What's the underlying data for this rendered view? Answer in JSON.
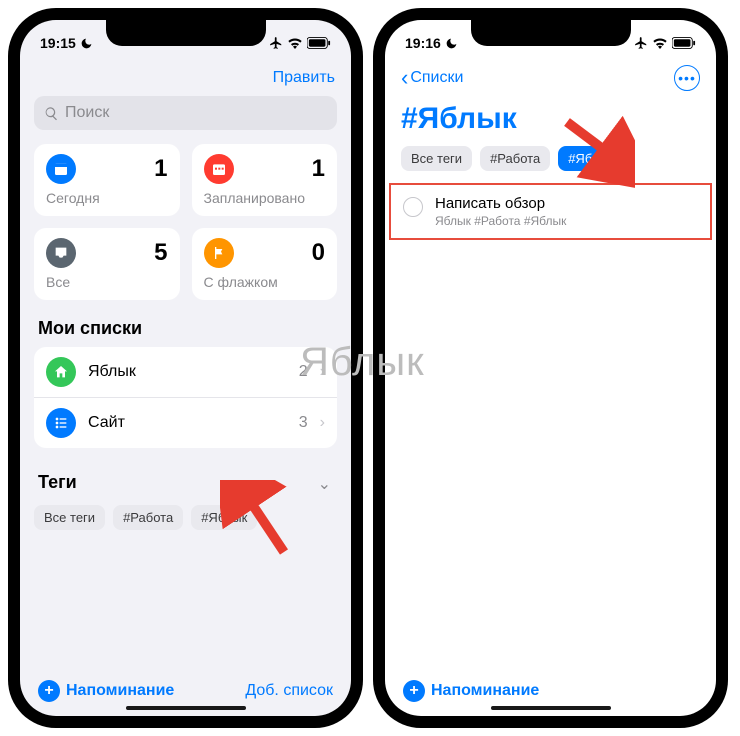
{
  "watermark": "Яблык",
  "left": {
    "status": {
      "time": "19:15"
    },
    "nav": {
      "edit": "Править"
    },
    "search": {
      "placeholder": "Поиск"
    },
    "cards": [
      {
        "label": "Сегодня",
        "count": "1",
        "color": "#007aff"
      },
      {
        "label": "Запланировано",
        "count": "1",
        "color": "#ff3b30"
      },
      {
        "label": "Все",
        "count": "5",
        "color": "#5b6670"
      },
      {
        "label": "С флажком",
        "count": "0",
        "color": "#ff9500"
      }
    ],
    "mylists_title": "Мои списки",
    "lists": [
      {
        "label": "Яблык",
        "count": "2",
        "color": "#34c759"
      },
      {
        "label": "Сайт",
        "count": "3",
        "color": "#007aff"
      }
    ],
    "tags_title": "Теги",
    "tags": [
      "Все теги",
      "#Работа",
      "#Яблык"
    ],
    "bottom": {
      "new": "Напоминание",
      "addlist": "Доб. список"
    }
  },
  "right": {
    "status": {
      "time": "19:16"
    },
    "nav": {
      "back": "Списки"
    },
    "title": "#Яблык",
    "tags": [
      {
        "label": "Все теги",
        "selected": false
      },
      {
        "label": "#Работа",
        "selected": false
      },
      {
        "label": "#Яблык",
        "selected": true
      }
    ],
    "task": {
      "title": "Написать обзор",
      "sub": "Яблык #Работа #Яблык"
    },
    "bottom": {
      "new": "Напоминание"
    }
  }
}
